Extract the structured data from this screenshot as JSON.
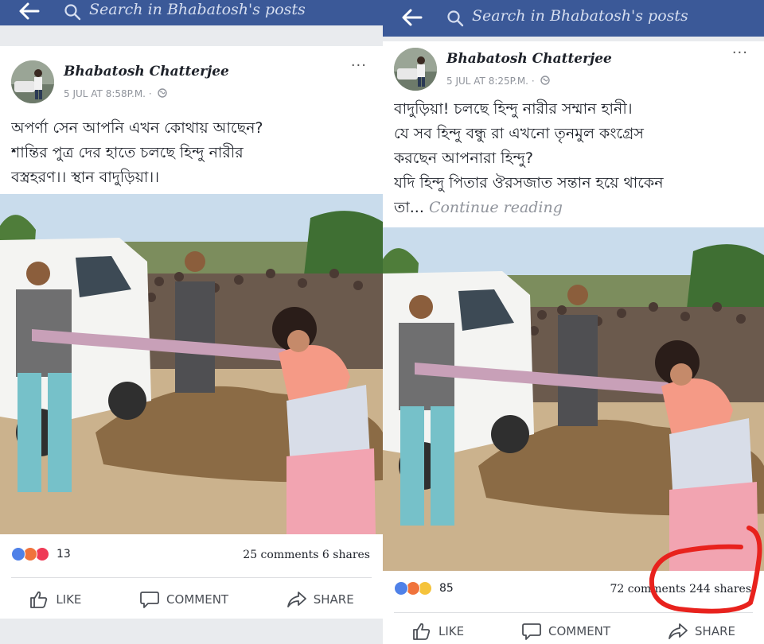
{
  "colors": {
    "header_blue": "#3b5998",
    "annotation_red": "#e8221d",
    "link_gray": "#90949c"
  },
  "left_post": {
    "search_placeholder": "Search in Bhabatosh's posts",
    "author": "Bhabatosh Chatterjee",
    "timestamp": "5 JUL AT 8:58P.M.",
    "separator": "·",
    "more": "···",
    "text_lines": [
      "অপর্ণা সেন আপনি এখন কোথায় আছেন?",
      "শান্তির পুত্র দের হাতে চলছে হিন্দু নারীর",
      "বস্ত্রহরণ।। স্থান বাদুড়িয়া।।"
    ],
    "reaction_count": "13",
    "stats": "25 comments 6 shares",
    "actions": {
      "like": "LIKE",
      "comment": "COMMENT",
      "share": "SHARE"
    }
  },
  "right_post": {
    "search_placeholder": "Search in Bhabatosh's posts",
    "author": "Bhabatosh Chatterjee",
    "timestamp": "5 JUL AT 8:25P.M.",
    "separator": "·",
    "more": "···",
    "text_lines": [
      "বাদুড়িয়া! চলছে হিন্দু নারীর সম্মান হানী।",
      "যে সব হিন্দু বন্ধু রা এখনো তৃনমুল কংগ্রেস",
      "করছেন আপনারা হিন্দু?",
      "যদি হিন্দু পিতার ঔরসজাত সন্তান হয়ে থাকেন"
    ],
    "last_line_start": "তা...",
    "continue_reading": "Continue reading",
    "reaction_count": "85",
    "stats": "72 comments 244 shares",
    "actions": {
      "like": "LIKE",
      "comment": "COMMENT",
      "share": "SHARE"
    }
  }
}
